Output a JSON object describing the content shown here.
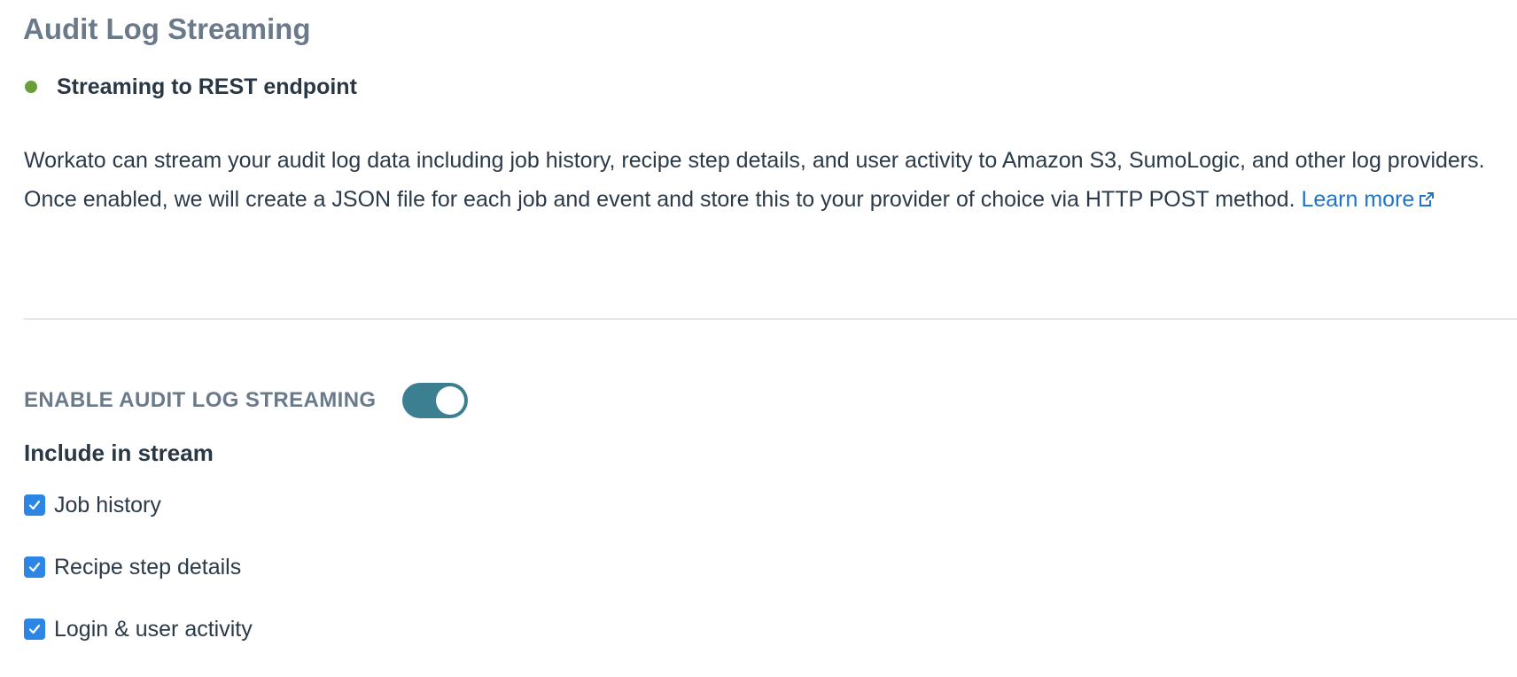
{
  "header": {
    "title": "Audit Log Streaming"
  },
  "status": {
    "text": "Streaming to REST endpoint",
    "color": "#6a9e3a"
  },
  "description": {
    "text": "Workato can stream your audit log data including job history, recipe step details, and user activity to Amazon S3, SumoLogic, and other log providers. Once enabled, we will create a JSON file for each job and event and store this to your provider of choice via HTTP POST method.",
    "link_label": "Learn more",
    "link_icon": "external-link-icon"
  },
  "toggle": {
    "label": "ENABLE AUDIT LOG STREAMING",
    "enabled": true,
    "on_color": "#3c7f91"
  },
  "include": {
    "heading": "Include in stream",
    "checkbox_color": "#2d86e6",
    "options": [
      {
        "label": "Job history",
        "checked": true
      },
      {
        "label": "Recipe step details",
        "checked": true
      },
      {
        "label": "Login & user activity",
        "checked": true
      }
    ]
  }
}
